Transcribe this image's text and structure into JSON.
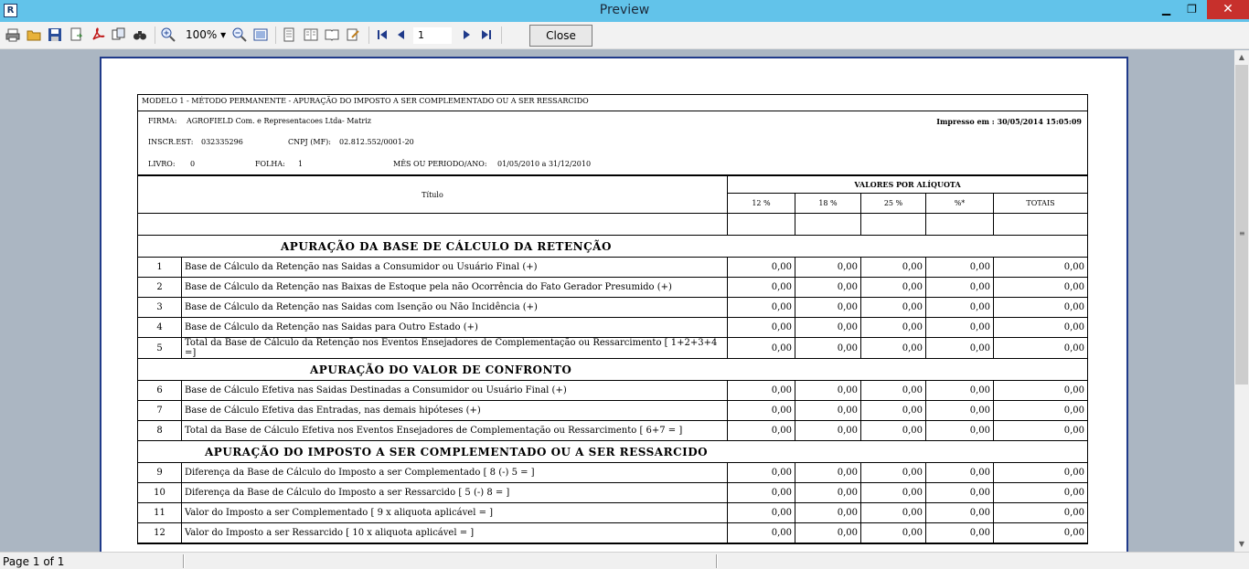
{
  "window": {
    "title": "Preview",
    "minimize": "▁",
    "maximize": "❐",
    "close": "✕"
  },
  "toolbar": {
    "zoom": "100%",
    "zoom_arrow": "▾",
    "page": "1",
    "close_label": "Close"
  },
  "status": {
    "page_text": "Page 1 of 1"
  },
  "report": {
    "header_title": "MODELO 1 - MÉTODO PERMANENTE - APURAÇÃO DO IMPOSTO A SER COMPLEMENTADO OU A SER RESSARCIDO",
    "firma_label": "FIRMA:",
    "firma_value": "AGROFIELD Com. e Representacoes Ltda- Matriz",
    "impresso": "Impresso em : 30/05/2014 15:05:09",
    "inscr_label": "INSCR.EST:",
    "inscr_value": "032335296",
    "cnpj_label": "CNPJ (MF):",
    "cnpj_value": "02.812.552/0001-20",
    "livro_label": "LIVRO:",
    "livro_value": "0",
    "folha_label": "FOLHA:",
    "folha_value": "1",
    "periodo_label": "MÊS OU PERIODO/ANO:",
    "periodo_value": "01/05/2010 a 31/12/2010",
    "titulo_label": "Título",
    "valores_label": "VALORES POR ALÍQUOTA",
    "columns": [
      "12 %",
      "18 %",
      "25 %",
      "%*",
      "TOTAIS"
    ],
    "sections": [
      {
        "title": "APURAÇÃO DA BASE DE CÁLCULO DA RETENÇÃO",
        "rows": [
          {
            "n": "1",
            "label": "Base de Cálculo da Retenção nas Saidas a Consumidor ou Usuário Final (+)",
            "v": [
              "0,00",
              "0,00",
              "0,00",
              "0,00",
              "0,00"
            ]
          },
          {
            "n": "2",
            "label": "Base de Cálculo da Retenção nas Baixas de Estoque pela não Ocorrência do Fato Gerador Presumido (+)",
            "v": [
              "0,00",
              "0,00",
              "0,00",
              "0,00",
              "0,00"
            ]
          },
          {
            "n": "3",
            "label": "Base de Cálculo da Retenção nas Saidas com Isenção ou Não Incidência (+)",
            "v": [
              "0,00",
              "0,00",
              "0,00",
              "0,00",
              "0,00"
            ]
          },
          {
            "n": "4",
            "label": "Base de Cálculo da Retenção nas Saidas para Outro Estado (+)",
            "v": [
              "0,00",
              "0,00",
              "0,00",
              "0,00",
              "0,00"
            ]
          },
          {
            "n": "5",
            "label": "Total da Base de Cálculo da Retenção nos Eventos Ensejadores de Complementação ou Ressarcimento [ 1+2+3+4 =]",
            "v": [
              "0,00",
              "0,00",
              "0,00",
              "0,00",
              "0,00"
            ]
          }
        ]
      },
      {
        "title": "APURAÇÃO DO VALOR DE CONFRONTO",
        "rows": [
          {
            "n": "6",
            "label": "Base de Cálculo Efetiva nas Saidas Destinadas a Consumidor ou Usuário Final (+)",
            "v": [
              "0,00",
              "0,00",
              "0,00",
              "0,00",
              "0,00"
            ]
          },
          {
            "n": "7",
            "label": "Base de Cálculo Efetiva das Entradas, nas demais hipóteses (+)",
            "v": [
              "0,00",
              "0,00",
              "0,00",
              "0,00",
              "0,00"
            ]
          },
          {
            "n": "8",
            "label": "Total da Base de Cálculo Efetiva nos Eventos Ensejadores de Complementação ou Ressarcimento [ 6+7 = ]",
            "v": [
              "0,00",
              "0,00",
              "0,00",
              "0,00",
              "0,00"
            ]
          }
        ]
      },
      {
        "title": "APURAÇÃO DO IMPOSTO A SER COMPLEMENTADO OU A SER RESSARCIDO",
        "rows": [
          {
            "n": "9",
            "label": "Diferença da Base de Cálculo do Imposto a ser Complementado [ 8 (-) 5 = ]",
            "v": [
              "0,00",
              "0,00",
              "0,00",
              "0,00",
              "0,00"
            ]
          },
          {
            "n": "10",
            "label": "Diferença da Base de Cálculo do Imposto a ser Ressarcido [ 5 (-) 8 = ]",
            "v": [
              "0,00",
              "0,00",
              "0,00",
              "0,00",
              "0,00"
            ]
          },
          {
            "n": "11",
            "label": "Valor do Imposto a ser Complementado [ 9 x aliquota aplicável = ]",
            "v": [
              "0,00",
              "0,00",
              "0,00",
              "0,00",
              "0,00"
            ]
          },
          {
            "n": "12",
            "label": "Valor do Imposto a ser Ressarcido [ 10 x aliquota aplicável = ]",
            "v": [
              "0,00",
              "0,00",
              "0,00",
              "0,00",
              "0,00"
            ]
          }
        ]
      }
    ]
  }
}
